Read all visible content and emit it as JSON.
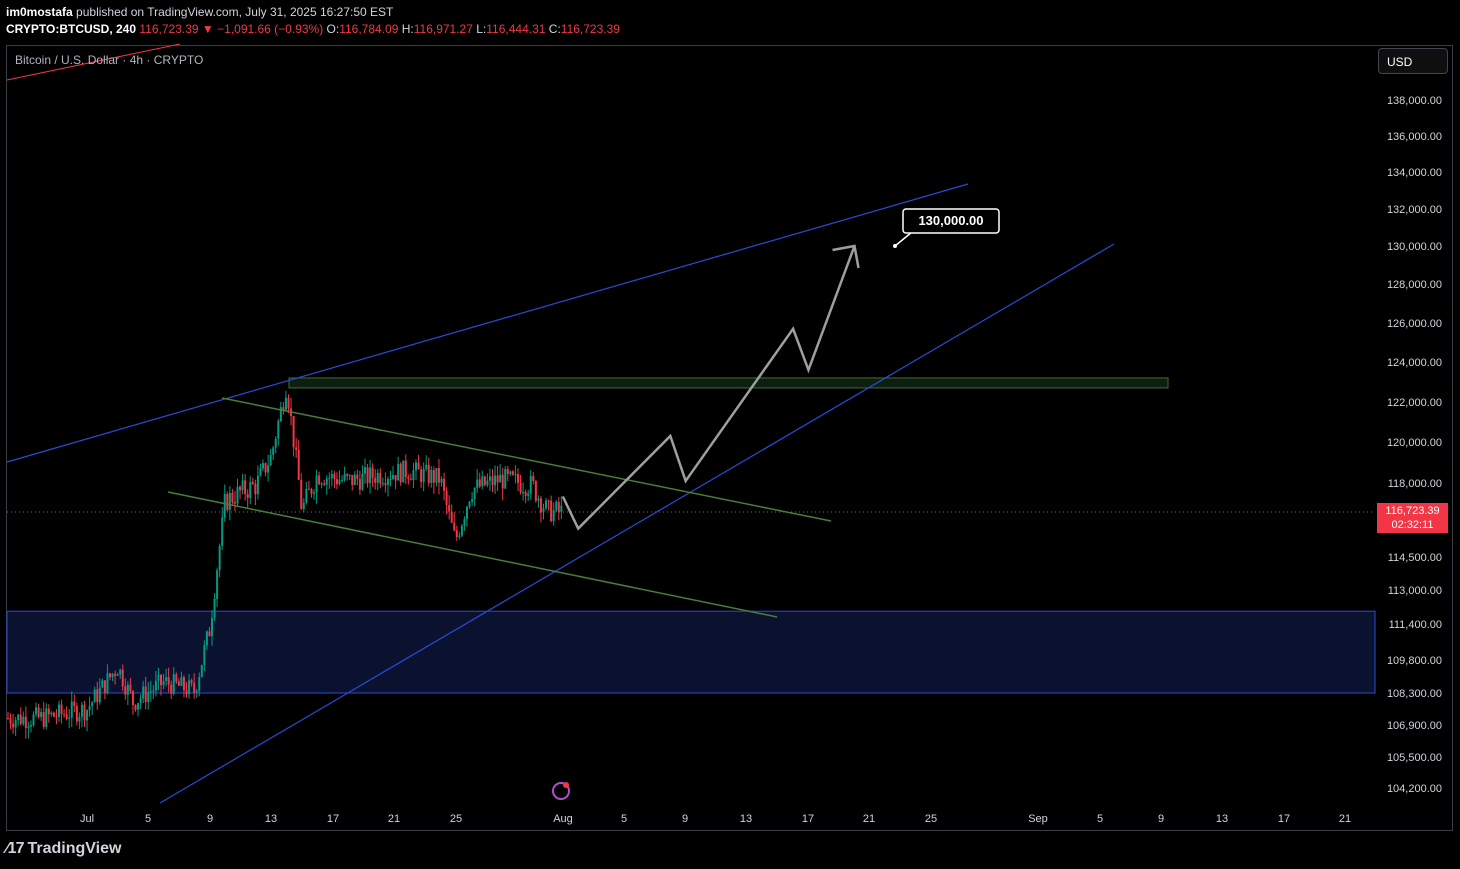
{
  "header": {
    "author": "im0mostafa",
    "published_text": "published on TradingView.com, July 31, 2025 16:27:50 EST",
    "symbol_line": {
      "symbol": "CRYPTO:BTCUSD, 240",
      "last": "116,723.39",
      "change": "−1,091.66 (−0.93%)",
      "open_label": "O:",
      "open": "116,784.09",
      "high_label": "H:",
      "high": "116,971.27",
      "low_label": "L:",
      "low": "116,444.31",
      "close_label": "C:",
      "close": "116,723.39"
    }
  },
  "pane_title": "Bitcoin / U.S. Dollar · 4h · CRYPTO",
  "currency_button": "USD",
  "price_tag": {
    "price": "116,723.39",
    "countdown": "02:32:11"
  },
  "brand": "TradingView",
  "colors": {
    "up": "#089981",
    "down": "#f23645",
    "trendline_blue": "#2a4bd7",
    "channel_green": "#4a7d3c",
    "zone_blue": "#0b1230",
    "projection": "#9e9e9e"
  },
  "chart_data": {
    "type": "candlestick",
    "title": "Bitcoin / U.S. Dollar · 4h · CRYPTO",
    "y_ticks": [
      "138,000.00",
      "136,000.00",
      "134,000.00",
      "132,000.00",
      "130,000.00",
      "128,000.00",
      "126,000.00",
      "124,000.00",
      "122,000.00",
      "120,000.00",
      "118,000.00",
      "114,500.00",
      "113,000.00",
      "111,400.00",
      "109,800.00",
      "108,300.00",
      "106,900.00",
      "105,500.00",
      "104,200.00"
    ],
    "x_ticks": [
      "Jul",
      "5",
      "9",
      "13",
      "17",
      "21",
      "25",
      "Aug",
      "5",
      "9",
      "13",
      "17",
      "21",
      "25",
      "Sep",
      "5",
      "9",
      "13",
      "17",
      "21"
    ],
    "scale": "log",
    "last_price": 116723.39,
    "target_label": "130,000.00",
    "target_price": 130000,
    "resistance_zone": [
      122700,
      123200
    ],
    "support_zone": [
      108300,
      112000
    ],
    "series": [
      {
        "name": "BTCUSD 4h closes (sampled)",
        "x": [
          "Jun 28",
          "Jul 1",
          "Jul 3",
          "Jul 4",
          "Jul 6",
          "Jul 8",
          "Jul 9",
          "Jul 10",
          "Jul 11",
          "Jul 12",
          "Jul 13",
          "Jul 14",
          "Jul 15",
          "Jul 16",
          "Jul 18",
          "Jul 20",
          "Jul 22",
          "Jul 24",
          "Jul 25",
          "Jul 26",
          "Jul 28",
          "Jul 30",
          "Jul 31"
        ],
        "values": [
          107200,
          107600,
          109500,
          107900,
          108800,
          108400,
          111200,
          117200,
          117600,
          117900,
          119300,
          122900,
          116800,
          118400,
          118100,
          118400,
          118600,
          118200,
          115300,
          117700,
          118200,
          117900,
          116723
        ]
      }
    ],
    "projection_path": [
      {
        "date": "Aug 1",
        "price": 117400
      },
      {
        "date": "Aug 2",
        "price": 115900
      },
      {
        "date": "Aug 8",
        "price": 120300
      },
      {
        "date": "Aug 9",
        "price": 118100
      },
      {
        "date": "Aug 16",
        "price": 125700
      },
      {
        "date": "Aug 17",
        "price": 123600
      },
      {
        "date": "Aug 20",
        "price": 130000
      }
    ]
  }
}
